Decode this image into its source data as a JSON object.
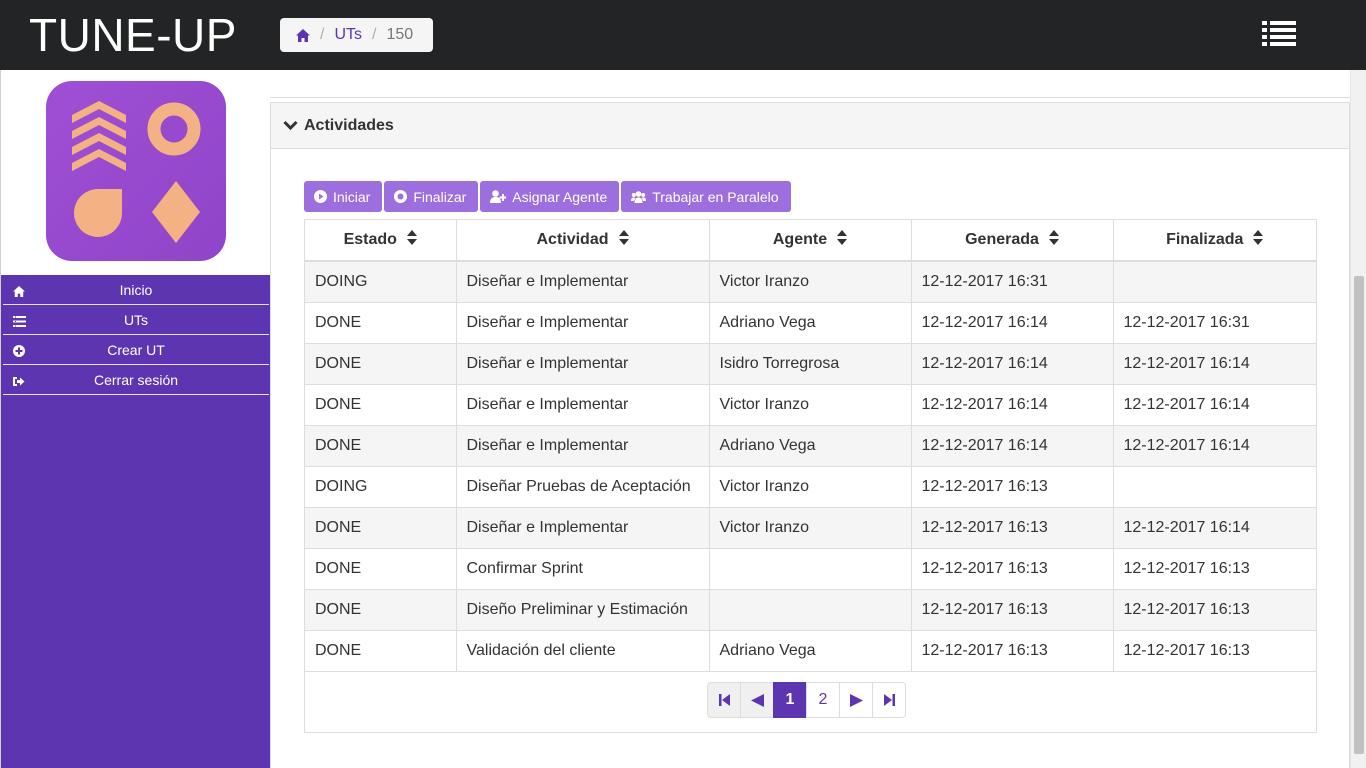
{
  "app": {
    "brand": "TUNE-UP"
  },
  "breadcrumb": {
    "home_icon": "home-icon",
    "section": "UTs",
    "current": "150"
  },
  "header": {
    "menu_icon": "list-icon"
  },
  "sidebar": {
    "logo_icon": "tune-up-logo",
    "items": [
      {
        "label": "Inicio",
        "icon": "home-icon"
      },
      {
        "label": "UTs",
        "icon": "list-icon"
      },
      {
        "label": "Crear UT",
        "icon": "plus-circle-icon"
      },
      {
        "label": "Cerrar sesión",
        "icon": "sign-out-icon"
      }
    ]
  },
  "panel": {
    "title": "Actividades"
  },
  "actions": {
    "start": "Iniciar",
    "finish": "Finalizar",
    "assign": "Asignar Agente",
    "parallel": "Trabajar en Paralelo"
  },
  "table": {
    "headers": [
      "Estado",
      "Actividad",
      "Agente",
      "Generada",
      "Finalizada"
    ],
    "rows": [
      [
        "DOING",
        "Diseñar e Implementar",
        "Victor Iranzo",
        "12-12-2017 16:31",
        ""
      ],
      [
        "DONE",
        "Diseñar e Implementar",
        "Adriano Vega",
        "12-12-2017 16:14",
        "12-12-2017 16:31"
      ],
      [
        "DONE",
        "Diseñar e Implementar",
        "Isidro Torregrosa",
        "12-12-2017 16:14",
        "12-12-2017 16:14"
      ],
      [
        "DONE",
        "Diseñar e Implementar",
        "Victor Iranzo",
        "12-12-2017 16:14",
        "12-12-2017 16:14"
      ],
      [
        "DONE",
        "Diseñar e Implementar",
        "Adriano Vega",
        "12-12-2017 16:14",
        "12-12-2017 16:14"
      ],
      [
        "DOING",
        "Diseñar Pruebas de Aceptación",
        "Victor Iranzo",
        "12-12-2017 16:13",
        ""
      ],
      [
        "DONE",
        "Diseñar e Implementar",
        "Victor Iranzo",
        "12-12-2017 16:13",
        "12-12-2017 16:14"
      ],
      [
        "DONE",
        "Confirmar Sprint",
        "",
        "12-12-2017 16:13",
        "12-12-2017 16:13"
      ],
      [
        "DONE",
        "Diseño Preliminar y Estimación",
        "",
        "12-12-2017 16:13",
        "12-12-2017 16:13"
      ],
      [
        "DONE",
        "Validación del cliente",
        "Adriano Vega",
        "12-12-2017 16:13",
        "12-12-2017 16:13"
      ]
    ]
  },
  "pagination": {
    "pages": [
      "1",
      "2"
    ],
    "current": "1"
  },
  "colors": {
    "accent": "#5e35b1",
    "button": "#9c6ede",
    "topbar": "#222426",
    "logo_bg": "#9c4fd0",
    "logo_shape": "#f4b183"
  }
}
